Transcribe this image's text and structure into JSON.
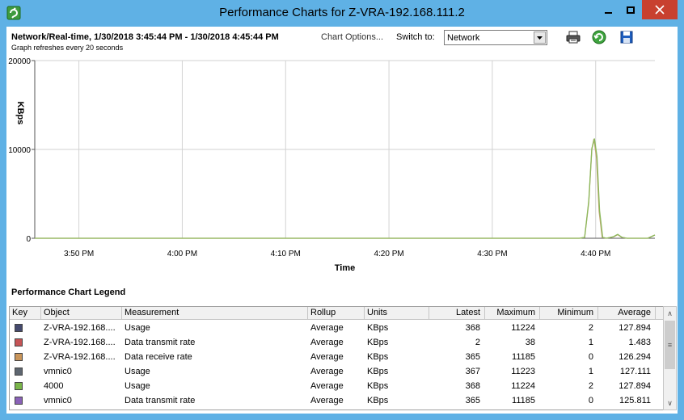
{
  "window": {
    "title": "Performance Charts for Z-VRA-192.168.111.2"
  },
  "header": {
    "title": "Network/Real-time, 1/30/2018 3:45:44 PM - 1/30/2018 4:45:44 PM",
    "chart_options": "Chart Options...",
    "refresh_note": "Graph refreshes every 20 seconds",
    "switch_label": "Switch to:",
    "switch_value": "Network"
  },
  "icons": {
    "app": "vsphere-app-icon",
    "print": "print-icon",
    "refresh": "refresh-icon",
    "save": "save-icon"
  },
  "chart_data": {
    "type": "line",
    "ylabel": "KBps",
    "xlabel": "Time",
    "ylim": [
      0,
      20000
    ],
    "yticks": [
      {
        "value": 20000,
        "label": "20000"
      },
      {
        "value": 10000,
        "label": "10000"
      },
      {
        "value": 0,
        "label": "0"
      }
    ],
    "xlim": [
      0,
      60
    ],
    "xticks": [
      {
        "value": 4.27,
        "label": "3:50 PM"
      },
      {
        "value": 14.27,
        "label": "4:00 PM"
      },
      {
        "value": 24.27,
        "label": "4:10 PM"
      },
      {
        "value": 34.27,
        "label": "4:20 PM"
      },
      {
        "value": 44.27,
        "label": "4:30 PM"
      },
      {
        "value": 54.27,
        "label": "4:40 PM"
      }
    ],
    "grid": true,
    "series": [
      {
        "name": "Data receive rate",
        "color": "#c9a77c",
        "points": [
          [
            0,
            0
          ],
          [
            52.7,
            0
          ],
          [
            53.2,
            100
          ],
          [
            53.6,
            4000
          ],
          [
            53.9,
            10000
          ],
          [
            54.1,
            11185
          ],
          [
            54.35,
            9000
          ],
          [
            54.6,
            3000
          ],
          [
            54.9,
            100
          ],
          [
            55.3,
            0
          ],
          [
            56.0,
            150
          ],
          [
            56.4,
            400
          ],
          [
            56.8,
            100
          ],
          [
            57.3,
            0
          ],
          [
            59.3,
            0
          ],
          [
            60,
            365
          ]
        ]
      },
      {
        "name": "Usage",
        "color": "#8bb85a",
        "points": [
          [
            0,
            0
          ],
          [
            52.7,
            0
          ],
          [
            53.2,
            100
          ],
          [
            53.6,
            4200
          ],
          [
            53.9,
            10100
          ],
          [
            54.15,
            11224
          ],
          [
            54.4,
            9200
          ],
          [
            54.65,
            3100
          ],
          [
            54.95,
            120
          ],
          [
            55.3,
            0
          ],
          [
            56.0,
            180
          ],
          [
            56.4,
            450
          ],
          [
            56.8,
            120
          ],
          [
            57.3,
            0
          ],
          [
            59.3,
            0
          ],
          [
            60,
            368
          ]
        ]
      }
    ]
  },
  "legend": {
    "title": "Performance Chart Legend",
    "columns": [
      "Key",
      "Object",
      "Measurement",
      "Rollup",
      "Units",
      "Latest",
      "Maximum",
      "Minimum",
      "Average"
    ],
    "rows": [
      {
        "color": "#454a6e",
        "object": "Z-VRA-192.168....",
        "measurement": "Usage",
        "rollup": "Average",
        "units": "KBps",
        "latest": "368",
        "maximum": "11224",
        "minimum": "2",
        "average": "127.894"
      },
      {
        "color": "#c65456",
        "object": "Z-VRA-192.168....",
        "measurement": "Data transmit rate",
        "rollup": "Average",
        "units": "KBps",
        "latest": "2",
        "maximum": "38",
        "minimum": "1",
        "average": "1.483"
      },
      {
        "color": "#c9955a",
        "object": "Z-VRA-192.168....",
        "measurement": "Data receive rate",
        "rollup": "Average",
        "units": "KBps",
        "latest": "365",
        "maximum": "11185",
        "minimum": "0",
        "average": "126.294"
      },
      {
        "color": "#5e6670",
        "object": "vmnic0",
        "measurement": "Usage",
        "rollup": "Average",
        "units": "KBps",
        "latest": "367",
        "maximum": "11223",
        "minimum": "1",
        "average": "127.111"
      },
      {
        "color": "#7ab54a",
        "object": "4000",
        "measurement": "Usage",
        "rollup": "Average",
        "units": "KBps",
        "latest": "368",
        "maximum": "11224",
        "minimum": "2",
        "average": "127.894"
      },
      {
        "color": "#8a62b8",
        "object": "vmnic0",
        "measurement": "Data transmit rate",
        "rollup": "Average",
        "units": "KBps",
        "latest": "365",
        "maximum": "11185",
        "minimum": "0",
        "average": "125.811"
      }
    ]
  }
}
